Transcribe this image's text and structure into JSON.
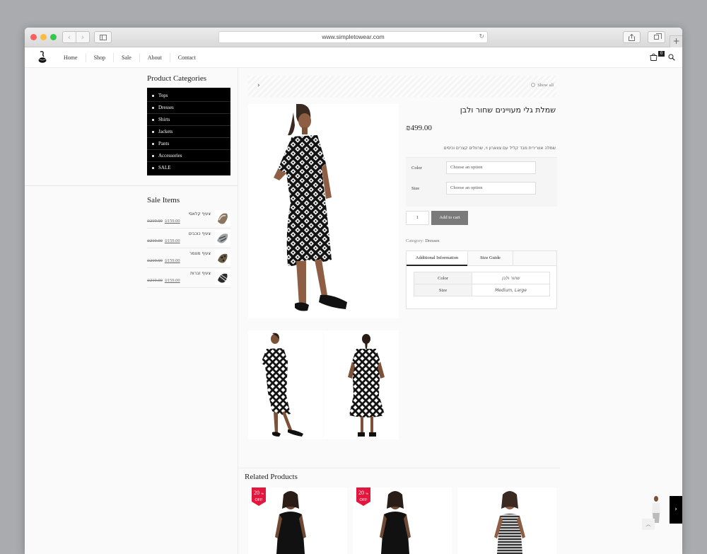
{
  "browser": {
    "url": "www.simpletowear.com",
    "back_icon": "chevron-left-icon",
    "forward_icon": "chevron-right-icon",
    "reload_icon": "reload-icon"
  },
  "header": {
    "nav": [
      "Home",
      "Shop",
      "Sale",
      "About",
      "Contact"
    ],
    "cart_count": "0"
  },
  "sidebar": {
    "categories_title": "Product Categories",
    "categories": [
      "Tops",
      "Dresses",
      "Shirts",
      "Jackets",
      "Pants",
      "Accessories",
      "SALE"
    ],
    "sale_title": "Sale Items",
    "sale_items": [
      {
        "name": "צעיף קלאסי",
        "old_price": "₪219.00",
        "price": "₪159.00"
      },
      {
        "name": "צעיף כוכבים",
        "old_price": "₪219.00",
        "price": "₪159.00"
      },
      {
        "name": "צעיף מנומר",
        "old_price": "₪219.00",
        "price": "₪159.00"
      },
      {
        "name": "צעיף זברות",
        "old_price": "₪219.00",
        "price": "₪159.00"
      }
    ]
  },
  "breadcrumb": {
    "arrow": "›",
    "show_all": "Show all"
  },
  "product": {
    "title": "שמלת גלי מעויינים שחור ולבן",
    "price": "₪499.00",
    "description": "שמלה אוורירית מבד קליל עם צווארון וי, שרוולים קצרים וכיסים",
    "color_label": "Color",
    "size_label": "Size",
    "color_placeholder": "Choose an option",
    "size_placeholder": "Choose an option",
    "quantity": "1",
    "add_to_cart": "Add to cart",
    "category_label": "Category:",
    "category_value": "Dresses",
    "tabs": [
      "Additional Information",
      "Size Guide"
    ],
    "attributes": [
      {
        "key": "Color",
        "value": "שחור ולבן"
      },
      {
        "key": "Size",
        "value": "Medium, Large"
      }
    ]
  },
  "related": {
    "title": "Related Products",
    "badges": [
      {
        "percent": "20",
        "unit": "%",
        "label": "OFF"
      },
      {
        "percent": "20",
        "unit": "%",
        "label": "OFF"
      }
    ]
  },
  "colors": {
    "badge_red": "#e3173e",
    "button_gray": "#7a7a7a",
    "category_box": "#000000"
  }
}
